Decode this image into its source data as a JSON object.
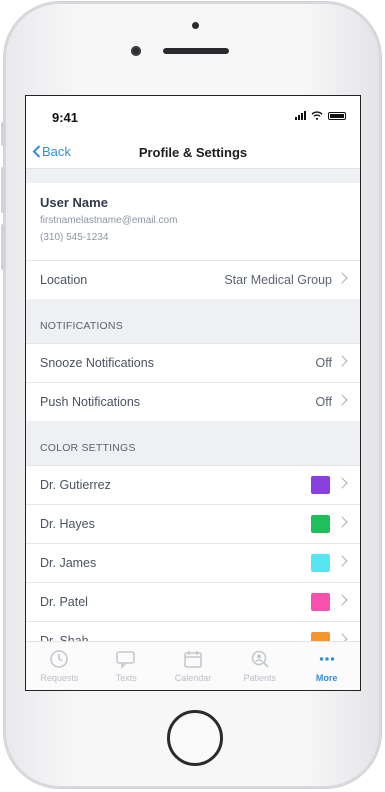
{
  "status_bar": {
    "time": "9:41"
  },
  "nav": {
    "back_label": "Back",
    "title": "Profile & Settings"
  },
  "user": {
    "name": "User Name",
    "email": "firstnamelastname@email.com",
    "phone": "(310) 545-1234"
  },
  "location": {
    "label": "Location",
    "value": "Star Medical Group"
  },
  "notifications": {
    "header": "NOTIFICATIONS",
    "items": [
      {
        "label": "Snooze Notifications",
        "value": "Off"
      },
      {
        "label": "Push Notifications",
        "value": "Off"
      }
    ]
  },
  "color_settings": {
    "header": "COLOR SETTINGS",
    "items": [
      {
        "label": "Dr. Gutierrez",
        "color": "#8a3fe0"
      },
      {
        "label": "Dr. Hayes",
        "color": "#1fbf5c"
      },
      {
        "label": "Dr. James",
        "color": "#56e6f2"
      },
      {
        "label": "Dr. Patel",
        "color": "#f750ad"
      },
      {
        "label": "Dr. Shah",
        "color": "#f5962a"
      }
    ]
  },
  "tabbar": {
    "items": [
      {
        "label": "Requests",
        "icon": "clock-icon"
      },
      {
        "label": "Texts",
        "icon": "chat-icon"
      },
      {
        "label": "Calendar",
        "icon": "calendar-icon"
      },
      {
        "label": "Patients",
        "icon": "search-person-icon"
      },
      {
        "label": "More",
        "icon": "more-dots-icon"
      }
    ],
    "active": "More"
  },
  "colors": {
    "accent": "#2f8fe6"
  }
}
